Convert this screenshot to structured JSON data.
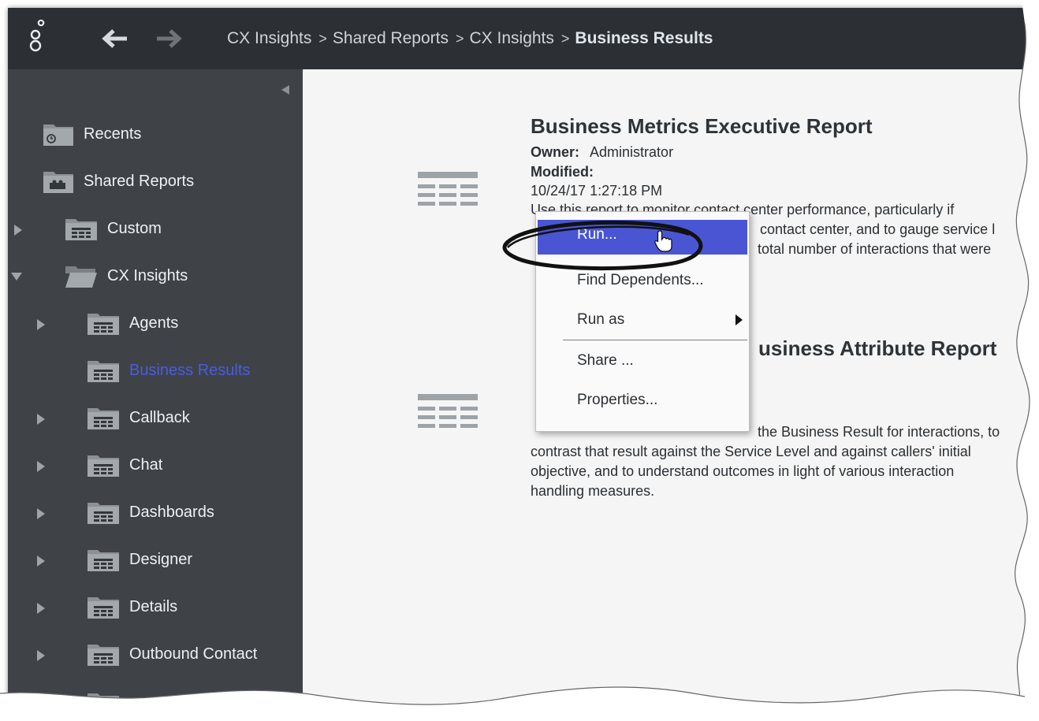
{
  "breadcrumb": {
    "items": [
      "CX Insights",
      "Shared Reports",
      "CX Insights"
    ],
    "separator": ">",
    "current": "Business Results"
  },
  "sidebar": {
    "items": [
      {
        "label": "Recents",
        "icon": "clock-folder-icon"
      },
      {
        "label": "Shared Reports",
        "icon": "shared-folder-icon"
      },
      {
        "label": "Custom",
        "icon": "report-folder-icon"
      },
      {
        "label": "CX Insights",
        "icon": "open-folder-icon"
      },
      {
        "label": "Agents",
        "icon": "report-folder-icon"
      },
      {
        "label": "Business Results",
        "icon": "report-folder-icon",
        "active": true
      },
      {
        "label": "Callback",
        "icon": "report-folder-icon"
      },
      {
        "label": "Chat",
        "icon": "report-folder-icon"
      },
      {
        "label": "Dashboards",
        "icon": "report-folder-icon"
      },
      {
        "label": "Designer",
        "icon": "report-folder-icon"
      },
      {
        "label": "Details",
        "icon": "report-folder-icon"
      },
      {
        "label": "Outbound Contact",
        "icon": "report-folder-icon"
      }
    ]
  },
  "reports": [
    {
      "title": "Business Metrics Executive Report",
      "owner_label": "Owner:",
      "owner": "Administrator",
      "modified_label": "Modified:",
      "modified": "10/24/17 1:27:18 PM",
      "desc_lines": [
        "Use this report to monitor contact center performance, particularly if",
        "contact center, and to gauge service l",
        "total number of interactions that were"
      ]
    },
    {
      "title": "usiness Attribute Report",
      "desc_lines": [
        "the Business Result for interactions, to",
        "contrast that result against the Service Level and against callers' initial",
        "objective, and to understand outcomes in light of various interaction",
        "handling measures."
      ]
    }
  ],
  "context_menu": {
    "items": [
      "Run...",
      "Find Dependents...",
      "Run as",
      "Share ...",
      "Properties..."
    ],
    "selected": "Run..."
  },
  "colors": {
    "topbar": "#2c3034",
    "sidebar": "#3f4347",
    "accent": "#4a55d4",
    "active_link": "#4a5cdf"
  }
}
